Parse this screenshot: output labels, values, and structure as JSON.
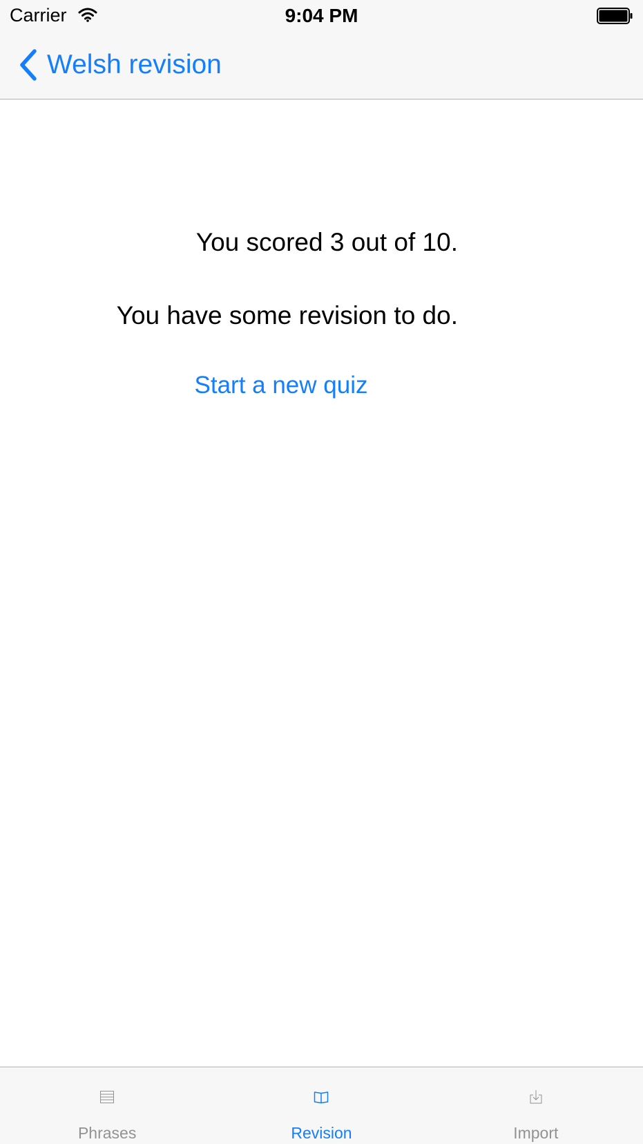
{
  "status_bar": {
    "carrier": "Carrier",
    "time": "9:04 PM",
    "wifi_icon": "wifi-icon",
    "battery_icon": "battery-icon"
  },
  "nav": {
    "back_label": "Welsh revision",
    "back_icon": "chevron-left-icon"
  },
  "result": {
    "score": "You scored 3 out of 10.",
    "message": "You have some revision to do.",
    "new_quiz_label": "Start a new quiz"
  },
  "tabs": [
    {
      "label": "Phrases",
      "icon": "list-icon",
      "active": false
    },
    {
      "label": "Revision",
      "icon": "book-icon",
      "active": true
    },
    {
      "label": "Import",
      "icon": "download-icon",
      "active": false
    }
  ],
  "colors": {
    "accent": "#147efb",
    "bar_background": "#f7f7f7",
    "inactive_tab": "#929292"
  }
}
